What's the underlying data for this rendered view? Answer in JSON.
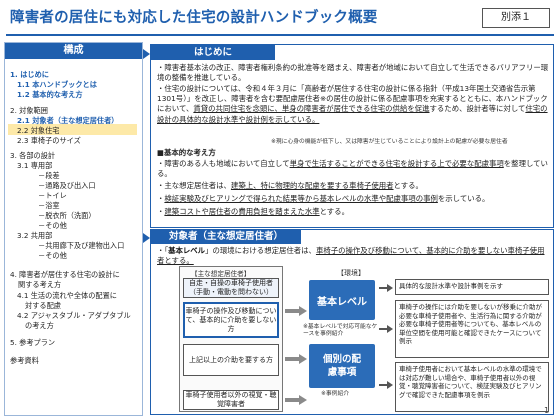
{
  "header": {
    "title": "障害者の居住にも対応した住宅の設計ハンドブック概要",
    "tag": "別添１"
  },
  "toc": {
    "heading": "構成",
    "items": [
      {
        "text": "1. はじめに",
        "level": 0,
        "active": true
      },
      {
        "text": "1.1  本ハンドブックとは",
        "level": 1,
        "active": true
      },
      {
        "text": "1.2  基本的な考え方",
        "level": 1,
        "active": true
      },
      {
        "text": "2. 対象範囲",
        "level": 0,
        "active": false
      },
      {
        "text": "2.1  対象者（主な想定居住者）",
        "level": 1,
        "active": true
      },
      {
        "text": "2.2  対象住宅",
        "level": 1,
        "active": false
      },
      {
        "text": "2.3  車椅子のサイズ",
        "level": 1,
        "active": false
      },
      {
        "text": "3. 各部の設計",
        "level": 0,
        "active": false
      },
      {
        "text": "3.1  専用部",
        "level": 1,
        "active": false
      },
      {
        "text": "－段差",
        "level": 2,
        "active": false
      },
      {
        "text": "－通路及び出入口",
        "level": 2,
        "active": false
      },
      {
        "text": "－トイレ",
        "level": 2,
        "active": false
      },
      {
        "text": "－浴室",
        "level": 2,
        "active": false
      },
      {
        "text": "－脱衣所（洗面）",
        "level": 2,
        "active": false
      },
      {
        "text": "－その他",
        "level": 2,
        "active": false
      },
      {
        "text": "3.2  共用部",
        "level": 1,
        "active": false
      },
      {
        "text": "－共用廊下及び建物出入口",
        "level": 2,
        "active": false
      },
      {
        "text": "－その他",
        "level": 2,
        "active": false
      },
      {
        "text": "4. 障害者が居住する住宅の設計に",
        "level": 0,
        "active": false
      },
      {
        "text": "関する考え方",
        "level": 1,
        "active": false
      },
      {
        "text": "4.1  生活の流れや全体の配置に",
        "level": 1,
        "active": false
      },
      {
        "text": "対する配慮",
        "level": 1,
        "active": false
      },
      {
        "text": "4.2  アジャスタブル・アダプタブル",
        "level": 1,
        "active": false
      },
      {
        "text": "の考え方",
        "level": 1,
        "active": false
      },
      {
        "text": "5. 参考プラン",
        "level": 0,
        "active": false
      },
      {
        "text": "参考資料",
        "level": 0,
        "active": false
      }
    ]
  },
  "section1": {
    "heading": "はじめに",
    "p1": "・障害者基本法の改正、障害者権利条約の批准等を踏まえ、障害者が地域において自立して生活できるバリアフリー環境の整備を推進している。",
    "p2a": "・住宅の設計については、令和４年３月に「高齢者が居住する住宅の設計に係る指針（平成13年国土交通省告示第1301号）」を改正し、障害者を含む要配慮居住者",
    "p2b": "の居住の設計に係る配慮事項を充実するとともに、本ハンドブックにおいて、",
    "p2u1": "賃貸の共同住宅を念頭に、単身の障害者が居住できる住宅の供給を促進",
    "p2c": "するため、設計者等に対して",
    "p2u2": "住宅の設計の具体的な設計水準や設計例を示している。",
    "p2note_mark": "※",
    "note": "※現に心身の機能が低下し、又は障害が生じていることにより設計上の配慮が必要な居住者",
    "basic_heading": "■基本的な考え方",
    "b1a": "・障害のある人も地域において自立して",
    "b1u": "単身で生活することができる住宅を設計する上で必要な配慮事項",
    "b1b": "を整理している。",
    "b2a": "・主な想定居住者は、",
    "b2u": "建築上、特に物理的な配慮を要する車椅子使用者",
    "b2b": "とする。",
    "b3a": "・",
    "b3u": "検証実験及びヒアリングで得られた結果等から基本レベルの水準や配慮事項の事例",
    "b3b": "を示している。",
    "b4a": "・",
    "b4u": "建築コストや居住者の費用負担を踏まえた水準",
    "b4b": "とする。"
  },
  "section2": {
    "heading": "対象者（主な想定居住者）",
    "intro_a": "・「",
    "intro_b": "基本レベル",
    "intro_c": "」の環境における想定居住者は、",
    "intro_u": "車椅子の操作及び移動について、基本的に介助を要しない車椅子使用者とする。",
    "users_title": "【主な想定居住者】",
    "user1": "自走・自操の車椅子使用者（手動・電動を問わない）",
    "user2": "車椅子の操作及び移動について、基本的に介助を要しない方",
    "user3": "上記以上の介助を要する方",
    "user4": "車椅子使用者以外の視覚・聴覚障害者",
    "cond_title": "【環境】",
    "basic_level": "基本レベル",
    "basic_note": "※基本レベルで対応可能なケースを事例紹介",
    "individual": "個別の配慮事項",
    "individual_note": "※事例紹介",
    "desc1": "具体的な設計水準や設計事例を示す",
    "desc2": "車椅子の操作には介助を要しないが移乗に介助が必要な車椅子使用者や、生活行為に関する介助が必要な車椅子使用者等についても、基本レベルの単位空間を使用可能と確認できたケースについて例示",
    "desc3": "車椅子使用者において基本レベルの水準の環境では対応が難しい場合や、車椅子使用者以外の視覚・聴覚障害者について、検証実験及びヒアリングで確認できた配慮事項を例示"
  },
  "footer": {
    "page": "1"
  }
}
